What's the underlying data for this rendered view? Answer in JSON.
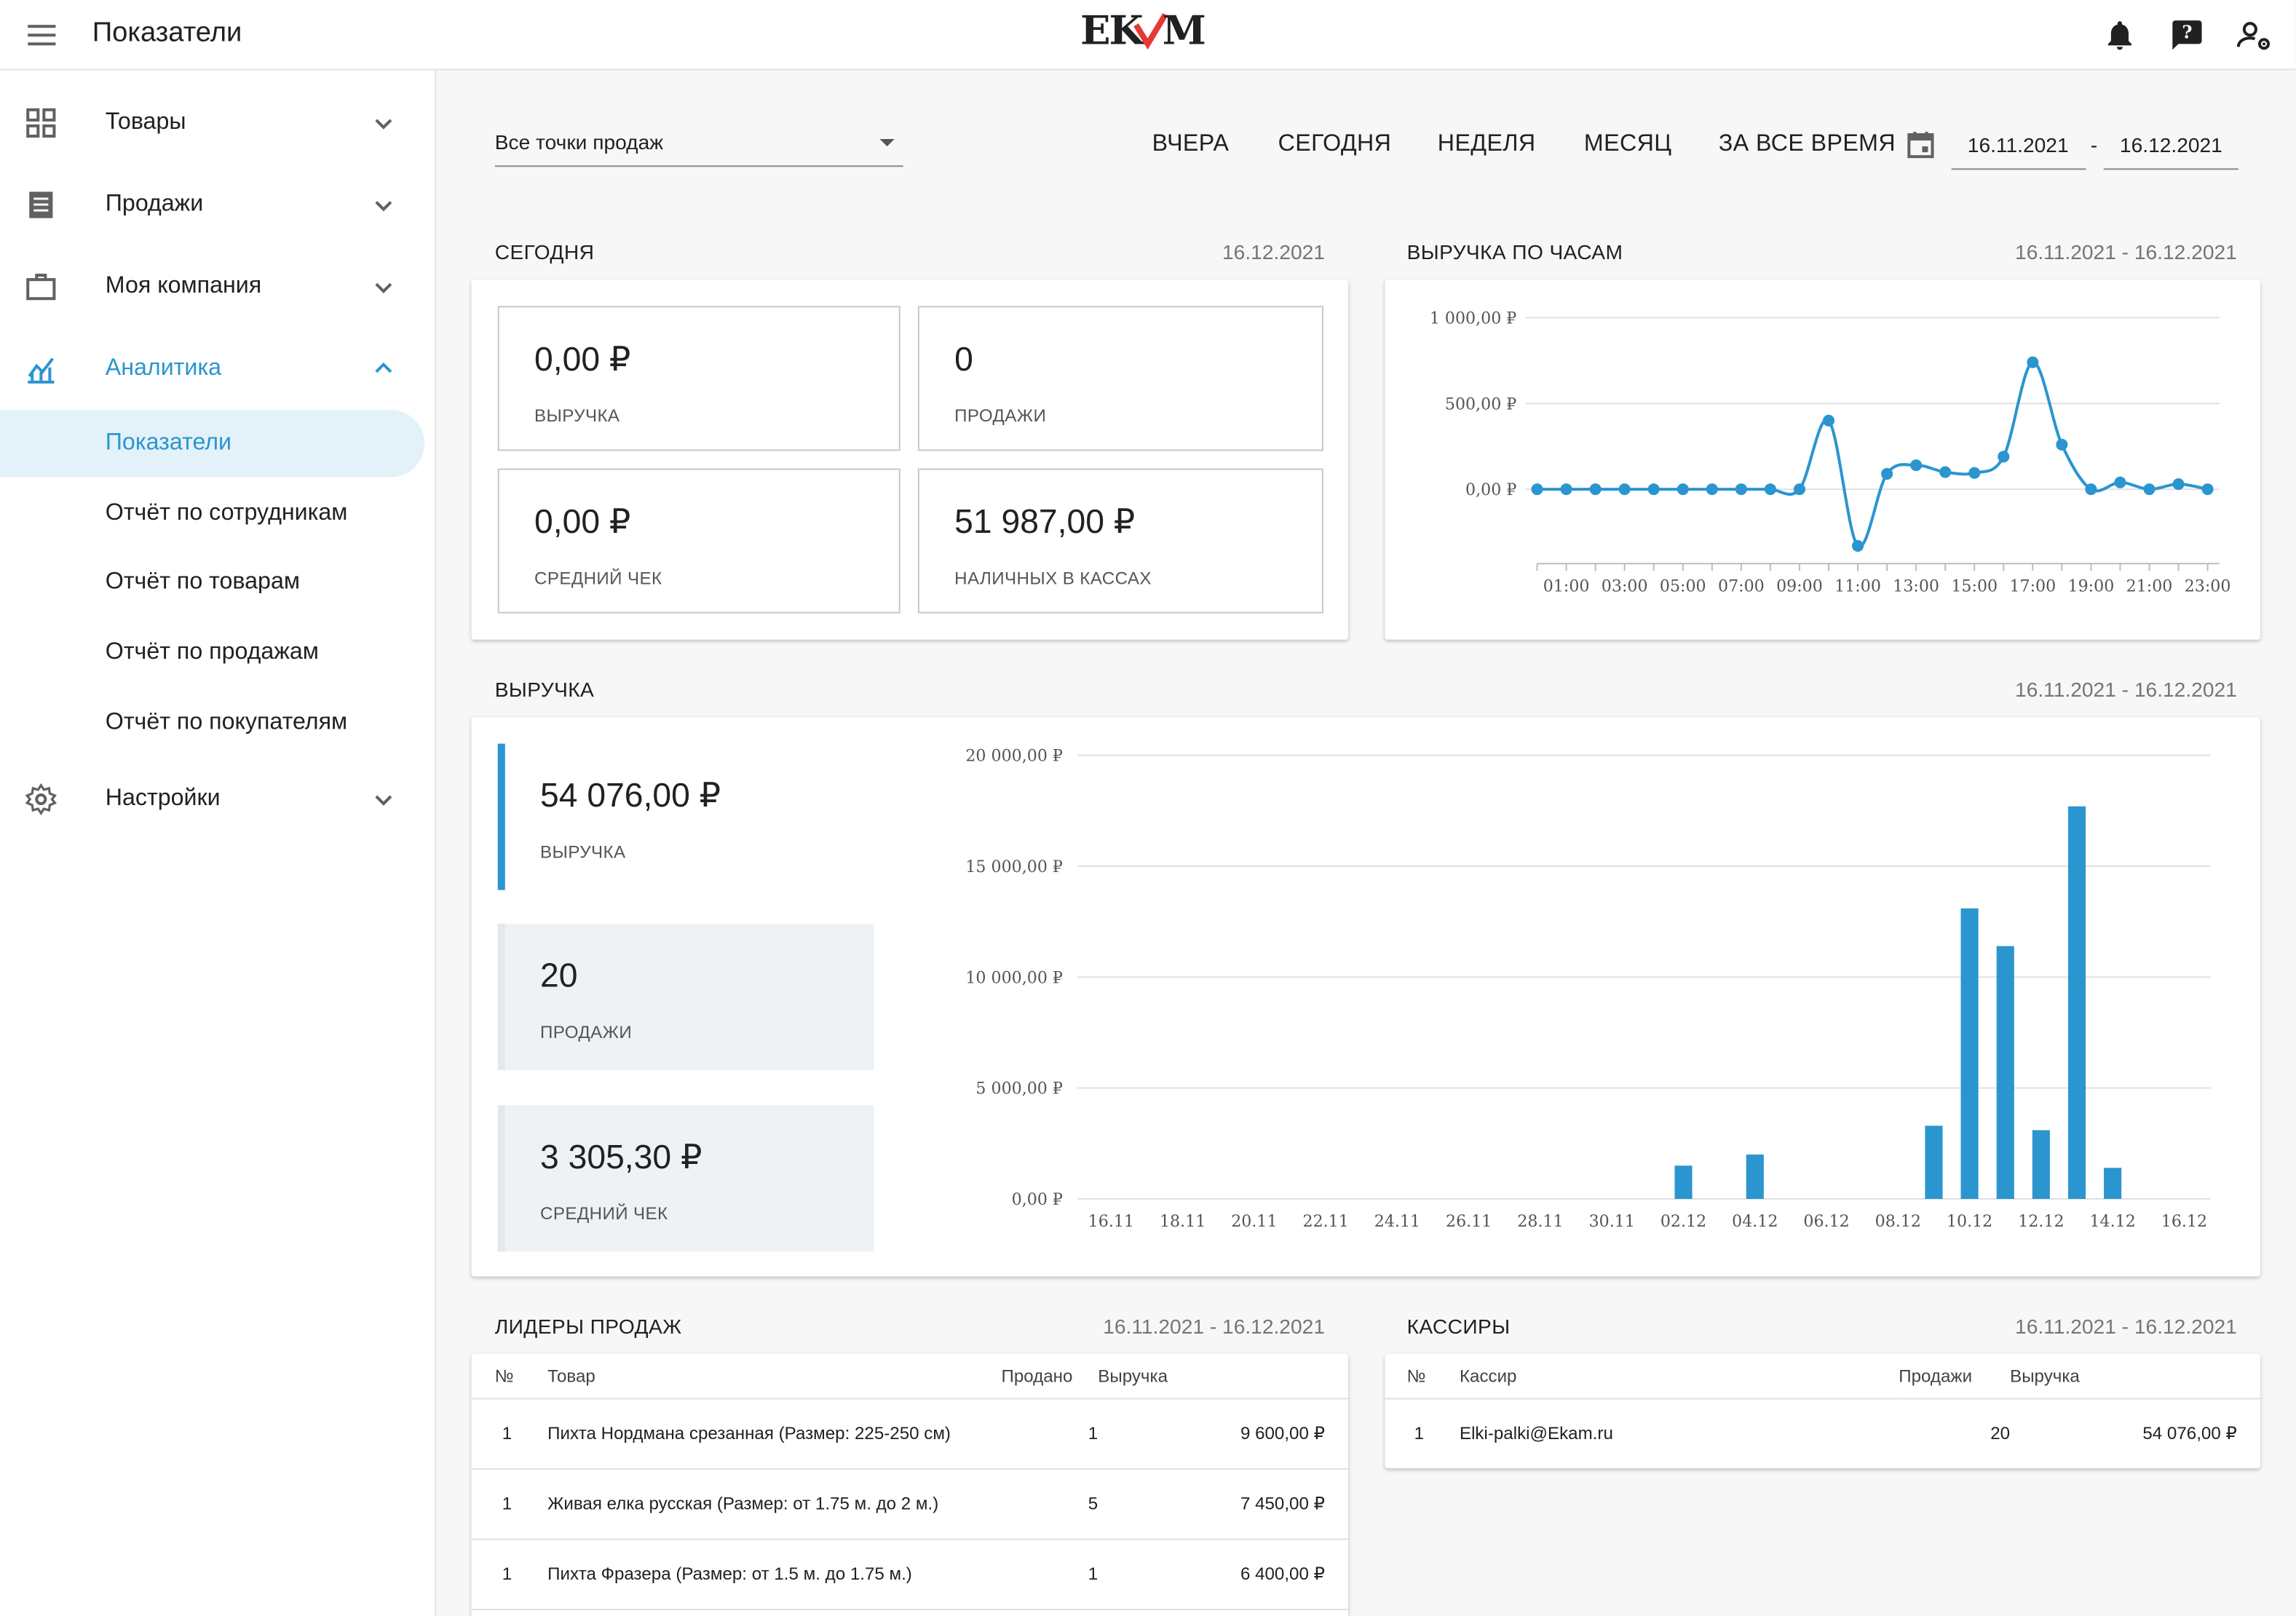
{
  "header": {
    "title": "Показатели",
    "logo_text": "EKAM"
  },
  "sidebar": {
    "items": [
      {
        "label": "Товары"
      },
      {
        "label": "Продажи"
      },
      {
        "label": "Моя компания"
      },
      {
        "label": "Аналитика"
      },
      {
        "label": "Настройки"
      }
    ],
    "analytics_sub": [
      {
        "label": "Показатели"
      },
      {
        "label": "Отчёт по сотрудникам"
      },
      {
        "label": "Отчёт по товарам"
      },
      {
        "label": "Отчёт по продажам"
      },
      {
        "label": "Отчёт по покупателям"
      }
    ]
  },
  "filters": {
    "point_of_sale": "Все точки продаж",
    "periods": [
      "ВЧЕРА",
      "СЕГОДНЯ",
      "НЕДЕЛЯ",
      "МЕСЯЦ",
      "ЗА ВСЕ ВРЕМЯ"
    ],
    "date_from": "16.11.2021",
    "date_to": "16.12.2021",
    "separator": "-"
  },
  "today": {
    "title": "СЕГОДНЯ",
    "date": "16.12.2021",
    "stats": [
      {
        "value": "0,00 ₽",
        "label": "ВЫРУЧКА"
      },
      {
        "value": "0",
        "label": "ПРОДАЖИ"
      },
      {
        "value": "0,00 ₽",
        "label": "СРЕДНИЙ ЧЕК"
      },
      {
        "value": "51 987,00 ₽",
        "label": "НАЛИЧНЫХ В КАССАХ"
      }
    ]
  },
  "hourly": {
    "title": "ВЫРУЧКА ПО ЧАСАМ",
    "range": "16.11.2021 - 16.12.2021"
  },
  "revenue": {
    "title": "ВЫРУЧКА",
    "range": "16.11.2021 - 16.12.2021",
    "stats": [
      {
        "value": "54 076,00 ₽",
        "label": "ВЫРУЧКА"
      },
      {
        "value": "20",
        "label": "ПРОДАЖИ"
      },
      {
        "value": "3 305,30 ₽",
        "label": "СРЕДНИЙ ЧЕК"
      }
    ]
  },
  "leaders": {
    "title": "ЛИДЕРЫ ПРОДАЖ",
    "range": "16.11.2021 - 16.12.2021",
    "columns": [
      "№",
      "Товар",
      "Продано",
      "Выручка"
    ],
    "rows": [
      {
        "n": "1",
        "product": "Пихта Нордмана срезанная (Размер: 225-250 см)",
        "sold": "1",
        "revenue": "9 600,00 ₽"
      },
      {
        "n": "1",
        "product": "Живая елка русская (Размер: от 1.75 м. до 2 м.)",
        "sold": "5",
        "revenue": "7 450,00 ₽"
      },
      {
        "n": "1",
        "product": "Пихта Фразера (Размер: от 1.5 м. до 1.75 м.)",
        "sold": "1",
        "revenue": "6 400,00 ₽"
      }
    ]
  },
  "cashiers": {
    "title": "КАССИРЫ",
    "range": "16.11.2021 - 16.12.2021",
    "columns": [
      "№",
      "Кассир",
      "Продажи",
      "Выручка"
    ],
    "rows": [
      {
        "n": "1",
        "cashier": "Elki-palki@Ekam.ru",
        "sales": "20",
        "revenue": "54 076,00 ₽"
      }
    ]
  },
  "colors": {
    "accent": "#2b95cf",
    "logo_red": "#e53935"
  },
  "chart_data": [
    {
      "type": "line",
      "y_tick_labels": [
        "1 000,00 ₽",
        "500,00 ₽",
        "0,00 ₽"
      ],
      "ylim": [
        -365,
        1000
      ],
      "x_tick_labels": [
        "01:00",
        "03:00",
        "05:00",
        "07:00",
        "09:00",
        "11:00",
        "13:00",
        "15:00",
        "17:00",
        "19:00",
        "21:00",
        "23:00"
      ],
      "x": [
        "00:00",
        "01:00",
        "02:00",
        "03:00",
        "04:00",
        "05:00",
        "06:00",
        "07:00",
        "08:00",
        "09:00",
        "10:00",
        "11:00",
        "12:00",
        "13:00",
        "14:00",
        "15:00",
        "16:00",
        "17:00",
        "18:00",
        "19:00",
        "20:00",
        "21:00",
        "22:00",
        "23:00"
      ],
      "values": [
        0,
        0,
        0,
        0,
        0,
        0,
        0,
        0,
        0,
        0,
        400,
        -330,
        90,
        140,
        100,
        95,
        190,
        740,
        260,
        0,
        40,
        0,
        30,
        0
      ],
      "grid": true
    },
    {
      "type": "bar",
      "y_tick_labels": [
        "20 000,00 ₽",
        "15 000,00 ₽",
        "10 000,00 ₽",
        "5 000,00 ₽",
        "0,00 ₽"
      ],
      "ylim": [
        0,
        20000
      ],
      "x_tick_labels": [
        "16.11",
        "18.11",
        "20.11",
        "22.11",
        "24.11",
        "26.11",
        "28.11",
        "30.11",
        "02.12",
        "04.12",
        "06.12",
        "08.12",
        "10.12",
        "12.12",
        "14.12",
        "16.12"
      ],
      "categories": [
        "16.11",
        "17.11",
        "18.11",
        "19.11",
        "20.11",
        "21.11",
        "22.11",
        "23.11",
        "24.11",
        "25.11",
        "26.11",
        "27.11",
        "28.11",
        "29.11",
        "30.11",
        "01.12",
        "02.12",
        "03.12",
        "04.12",
        "05.12",
        "06.12",
        "07.12",
        "08.12",
        "09.12",
        "10.12",
        "11.12",
        "12.12",
        "13.12",
        "14.12",
        "15.12",
        "16.12"
      ],
      "values": [
        0,
        0,
        0,
        0,
        0,
        0,
        0,
        0,
        0,
        0,
        0,
        0,
        0,
        0,
        0,
        0,
        1500,
        0,
        2000,
        0,
        0,
        0,
        0,
        3300,
        13100,
        11400,
        3100,
        17700,
        1400,
        0,
        0
      ],
      "grid": true
    }
  ]
}
